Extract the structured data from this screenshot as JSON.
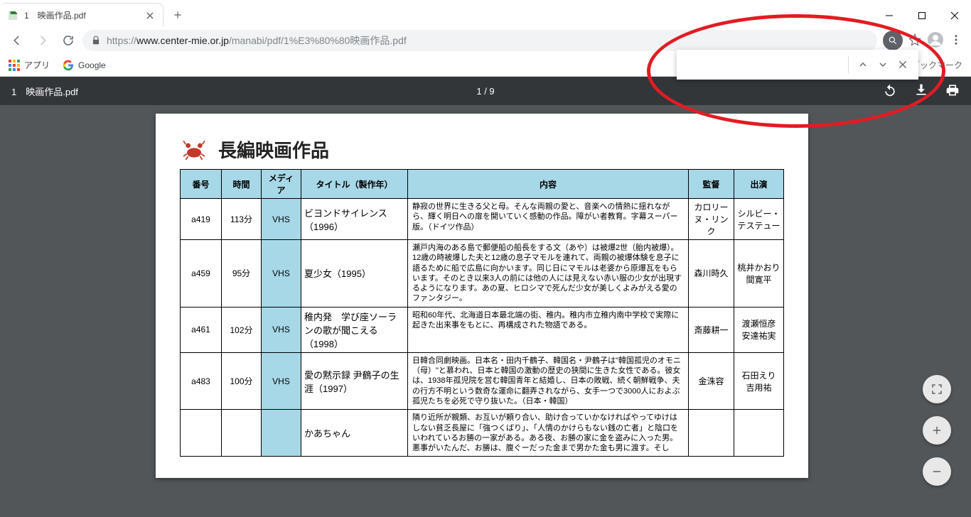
{
  "tab": {
    "title": "1　映画作品.pdf"
  },
  "url": {
    "scheme": "https://",
    "host": "www.center-mie.or.jp",
    "path": "/manabi/pdf/1%E3%80%80映画作品.pdf"
  },
  "bookmarks": {
    "apps": "アプリ",
    "google": "Google",
    "other": "のブックマーク"
  },
  "pdf": {
    "filename": "1　映画作品.pdf",
    "page_current": "1",
    "page_total": "9"
  },
  "findbar": {
    "placeholder": ""
  },
  "doc": {
    "heading": "長編映画作品",
    "headers": {
      "num": "番号",
      "time": "時間",
      "media": "メディア",
      "title": "タイトル（製作年）",
      "desc": "内容",
      "director": "監督",
      "cast": "出演"
    },
    "rows": [
      {
        "num": "a419",
        "time": "113分",
        "media": "VHS",
        "title": "ビヨンドサイレンス（1996）",
        "desc": "静寂の世界に生きる父と母。そんな両親の愛と、音楽への情熱に揺れながら、輝く明日への扉を開いていく感動の作品。障がい者教育。字幕スーパー版。（ドイツ作品）",
        "director": "カロリーヌ・リンク",
        "cast": "シルビー・テステュー"
      },
      {
        "num": "a459",
        "time": "95分",
        "media": "VHS",
        "title": "夏少女（1995）",
        "desc": "瀬戸内海のある島で郵便船の船長をする文（あや）は被爆2世（胎内被爆）。12歳の時被爆した夫と12歳の息子マモルを連れて、両親の被爆体験を息子に語るために船で広島に向かいます。同じ日にマモルは老婆から原爆瓦をもらいます。そのとき以来3人の前には他の人には見えない赤い服の少女が出現するようになります。あの夏、ヒロシマで死んだ少女が美しくよみがえる愛のファンタジー。",
        "director": "森川時久",
        "cast": "桃井かおり\n間寛平"
      },
      {
        "num": "a461",
        "time": "102分",
        "media": "VHS",
        "title": "稚内発　学び座ソーランの歌が聞こえる（1998）",
        "desc": "昭和60年代、北海道日本最北端の街、稚内。稚内市立稚内南中学校で実際に起きた出来事をもとに、再構成された物語である。",
        "director": "斎藤耕一",
        "cast": "渡瀬恒彦\n安達祐実"
      },
      {
        "num": "a483",
        "time": "100分",
        "media": "VHS",
        "title": "愛の黙示録 尹鶴子の生涯（1997）",
        "desc": "日韓合同劇映画。日本名・田内千鶴子、韓国名・尹鶴子は\"韓国孤児のオモニ（母）\"と慕われ、日本と韓国の激動の歴史の狭間に生きた女性である。彼女は、1938年孤児院を営む韓国青年と結婚し、日本の敗戦、続く朝鮮戦争、夫の行方不明という数奇な運命に翻弄されながら、女手一つで3000人におよぶ孤児たちを必死で守り抜いた。（日本・韓国）",
        "director": "金洙容",
        "cast": "石田えり\n吉用祐"
      },
      {
        "num": "",
        "time": "",
        "media": "",
        "title": "かあちゃん",
        "desc": "隣り近所が親類、お互いが頼り合い、助け合っていかなければやってゆけはしない貧乏長屋に「強つくばり」、「人情のかけらもない銭の亡者」と陰口をいわれているお勝の一家がある。ある夜、お勝の家に金を盗みに入った男。悪事がいたんだ、お勝は、腹ぐーだった金まで男かた金も男に渡す。そし",
        "director": "",
        "cast": ""
      }
    ]
  }
}
